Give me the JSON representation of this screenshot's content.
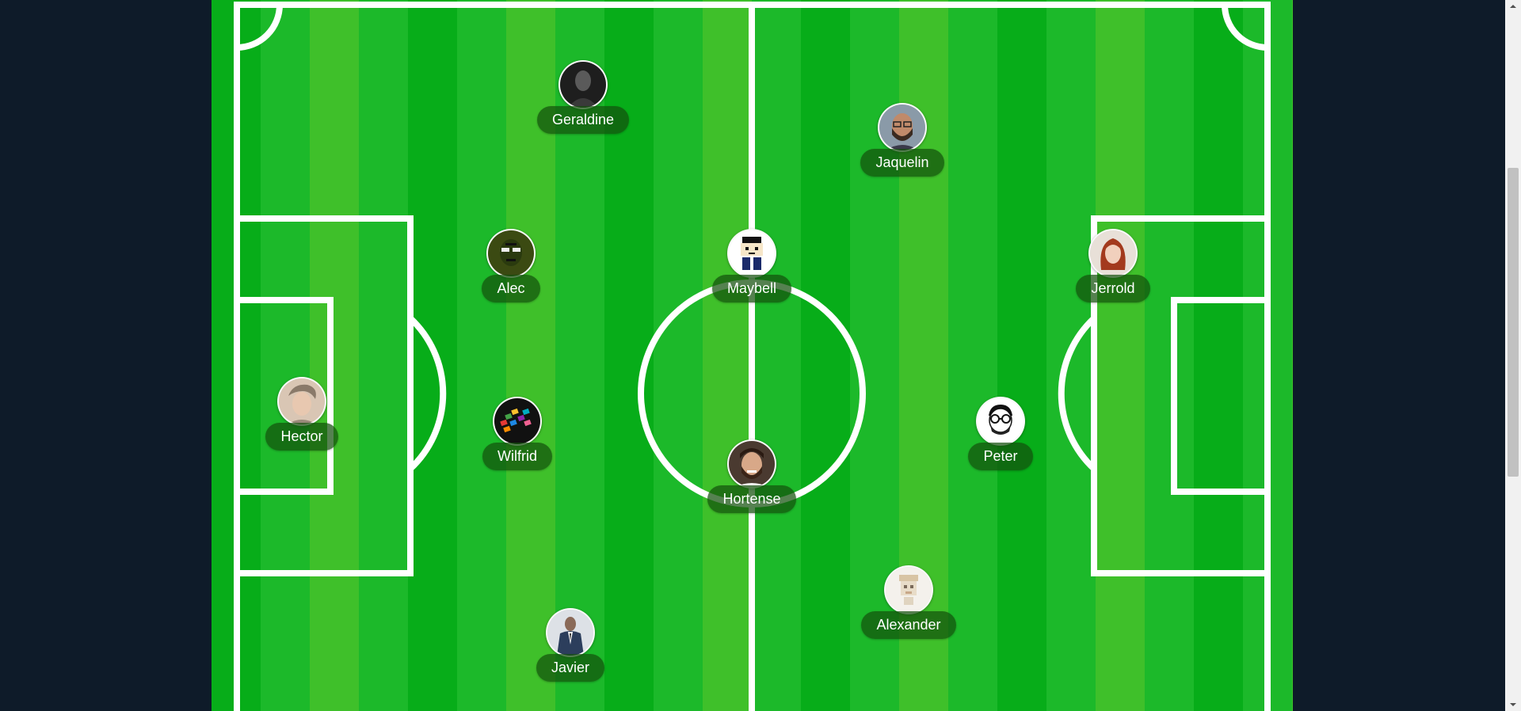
{
  "players": [
    {
      "name": "Geraldine",
      "avatar_icon": "dark-portrait-icon",
      "avatar_color": "#2a2a2a"
    },
    {
      "name": "Jaquelin",
      "avatar_icon": "bearded-man-glasses-icon",
      "avatar_color": "#6b4a3a"
    },
    {
      "name": "Alec",
      "avatar_icon": "cartoon-face-sunglasses-icon",
      "avatar_color": "#3b4a12"
    },
    {
      "name": "Maybell",
      "avatar_icon": "pixel-art-character-icon",
      "avatar_color": "#ffffff"
    },
    {
      "name": "Jerrold",
      "avatar_icon": "red-hair-woman-icon",
      "avatar_color": "#e8d8cc"
    },
    {
      "name": "Hector",
      "avatar_icon": "young-man-icon",
      "avatar_color": "#c9b8a8"
    },
    {
      "name": "Wilfrid",
      "avatar_icon": "colorful-blocks-icon",
      "avatar_color": "#111111"
    },
    {
      "name": "Hortense",
      "avatar_icon": "smiling-bearded-man-icon",
      "avatar_color": "#5a3a2a"
    },
    {
      "name": "Peter",
      "avatar_icon": "cartoon-glasses-beard-icon",
      "avatar_color": "#ffffff"
    },
    {
      "name": "Alexander",
      "avatar_icon": "pixel-face-icon",
      "avatar_color": "#f4f1ec"
    },
    {
      "name": "Javier",
      "avatar_icon": "man-in-suit-icon",
      "avatar_color": "#d8dce2"
    }
  ]
}
